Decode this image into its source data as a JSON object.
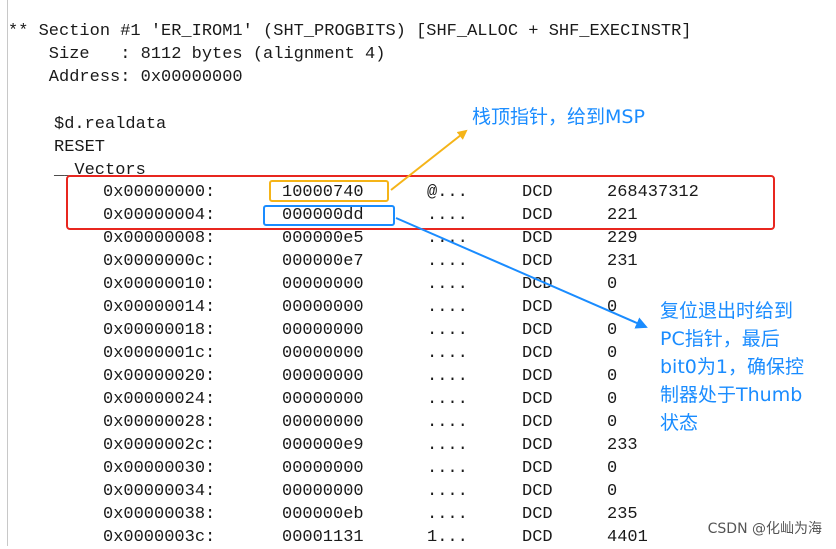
{
  "header": {
    "line1": "** Section #1 'ER_IROM1' (SHT_PROGBITS) [SHF_ALLOC + SHF_EXECINSTR]",
    "line2": "    Size   : 8112 bytes (alignment 4)",
    "line3": "    Address: 0x00000000"
  },
  "labels": {
    "symbol": "$d.realdata",
    "reset": "RESET",
    "vectors": "__Vectors"
  },
  "rows": [
    {
      "addr": "0x00000000:",
      "hex": "10000740",
      "chars": "@...",
      "op": "DCD",
      "val": "268437312"
    },
    {
      "addr": "0x00000004:",
      "hex": "000000dd",
      "chars": "....",
      "op": "DCD",
      "val": "221"
    },
    {
      "addr": "0x00000008:",
      "hex": "000000e5",
      "chars": "....",
      "op": "DCD",
      "val": "229"
    },
    {
      "addr": "0x0000000c:",
      "hex": "000000e7",
      "chars": "....",
      "op": "DCD",
      "val": "231"
    },
    {
      "addr": "0x00000010:",
      "hex": "00000000",
      "chars": "....",
      "op": "DCD",
      "val": "0"
    },
    {
      "addr": "0x00000014:",
      "hex": "00000000",
      "chars": "....",
      "op": "DCD",
      "val": "0"
    },
    {
      "addr": "0x00000018:",
      "hex": "00000000",
      "chars": "....",
      "op": "DCD",
      "val": "0"
    },
    {
      "addr": "0x0000001c:",
      "hex": "00000000",
      "chars": "....",
      "op": "DCD",
      "val": "0"
    },
    {
      "addr": "0x00000020:",
      "hex": "00000000",
      "chars": "....",
      "op": "DCD",
      "val": "0"
    },
    {
      "addr": "0x00000024:",
      "hex": "00000000",
      "chars": "....",
      "op": "DCD",
      "val": "0"
    },
    {
      "addr": "0x00000028:",
      "hex": "00000000",
      "chars": "....",
      "op": "DCD",
      "val": "0"
    },
    {
      "addr": "0x0000002c:",
      "hex": "000000e9",
      "chars": "....",
      "op": "DCD",
      "val": "233"
    },
    {
      "addr": "0x00000030:",
      "hex": "00000000",
      "chars": "....",
      "op": "DCD",
      "val": "0"
    },
    {
      "addr": "0x00000034:",
      "hex": "00000000",
      "chars": "....",
      "op": "DCD",
      "val": "0"
    },
    {
      "addr": "0x00000038:",
      "hex": "000000eb",
      "chars": "....",
      "op": "DCD",
      "val": "235"
    },
    {
      "addr": "0x0000003c:",
      "hex": "00001131",
      "chars": "1...",
      "op": "DCD",
      "val": "4401"
    }
  ],
  "annotations": {
    "msp": "栈顶指针，给到MSP",
    "reset_lines": [
      "复位退出时给到",
      "PC指针，最后",
      "bit0为1，确保控",
      "制器处于Thumb",
      "状态"
    ]
  },
  "watermark": "CSDN @化屾为海",
  "colors": {
    "red_box": "#e8261f",
    "orange_box": "#f5b418",
    "blue_box": "#1a8cff",
    "annotation_text": "#1a8cff"
  }
}
